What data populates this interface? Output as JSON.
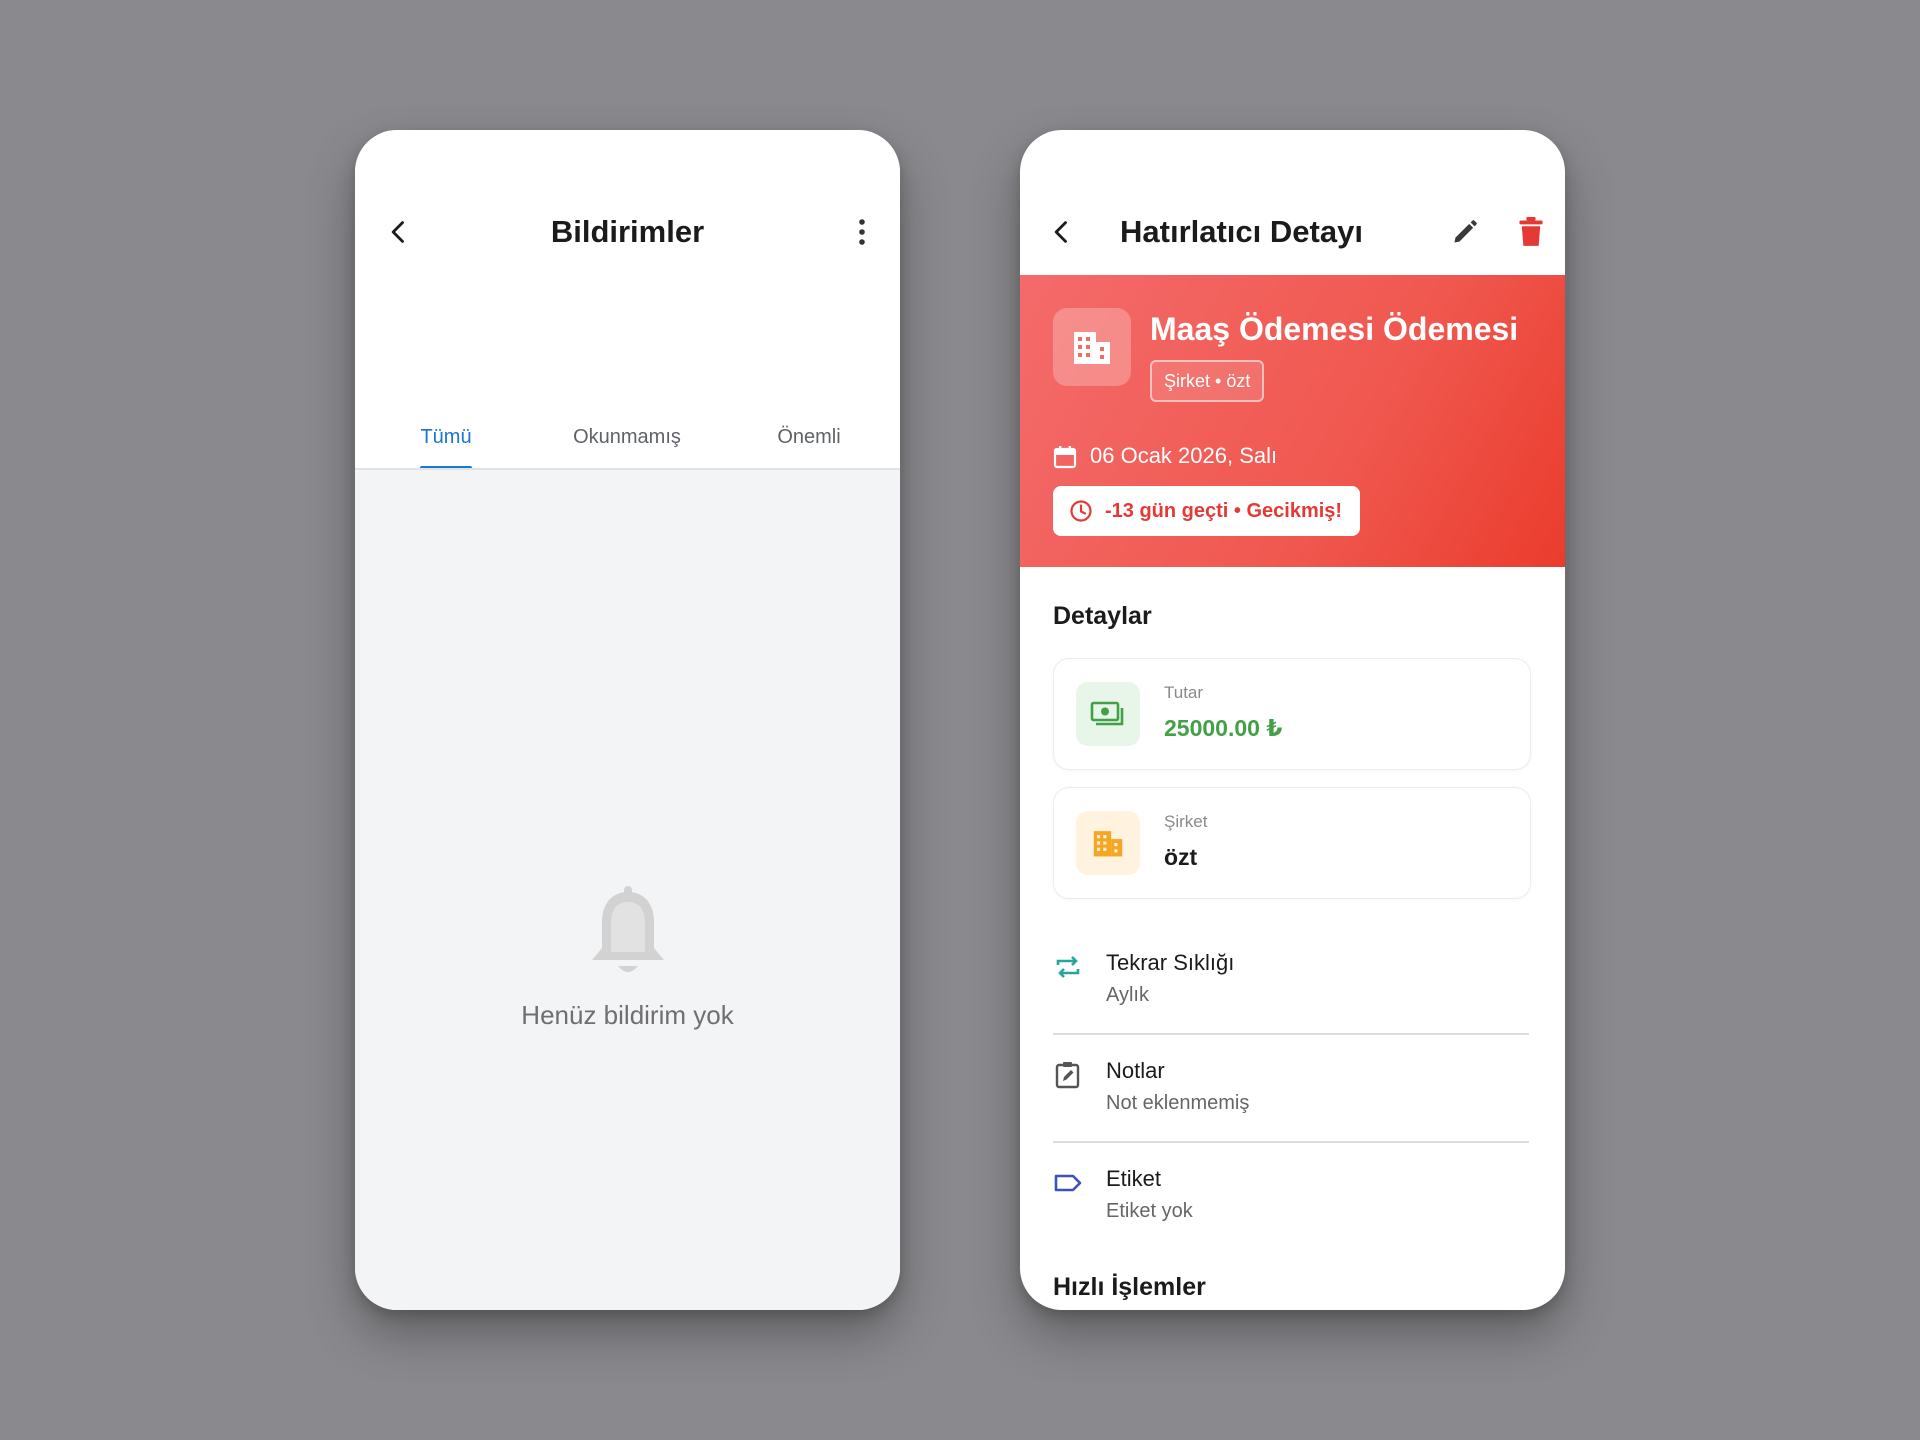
{
  "left_screen": {
    "title": "Bildirimler",
    "tabs": [
      {
        "label": "Tümü",
        "active": true
      },
      {
        "label": "Okunmamış",
        "active": false
      },
      {
        "label": "Önemli",
        "active": false
      }
    ],
    "empty_state": {
      "icon": "bell-icon",
      "message": "Henüz bildirim yok"
    }
  },
  "right_screen": {
    "title": "Hatırlatıcı Detayı",
    "hero": {
      "title": "Maaş Ödemesi Ödemesi",
      "tag": "Şirket • özt",
      "date": "06 Ocak 2026, Salı",
      "overdue": "-13 gün geçti • Gecikmiş!"
    },
    "details": {
      "section_title": "Detaylar",
      "amount": {
        "label": "Tutar",
        "value": "25000.00 ₺"
      },
      "company": {
        "label": "Şirket",
        "value": "özt"
      }
    },
    "rows": [
      {
        "title": "Tekrar Sıklığı",
        "subtitle": "Aylık",
        "icon": "repeat-icon"
      },
      {
        "title": "Notlar",
        "subtitle": "Not eklenmemiş",
        "icon": "note-edit-icon"
      },
      {
        "title": "Etiket",
        "subtitle": "Etiket yok",
        "icon": "label-icon"
      }
    ],
    "quick_actions_title": "Hızlı İşlemler"
  },
  "colors": {
    "accent_blue": "#1976d2",
    "hero_red": "#f0584f",
    "delete_red": "#e53935",
    "amount_green": "#43a047",
    "company_orange": "#f5a623",
    "repeat_teal": "#26a69a",
    "label_blue": "#3f51b5"
  }
}
